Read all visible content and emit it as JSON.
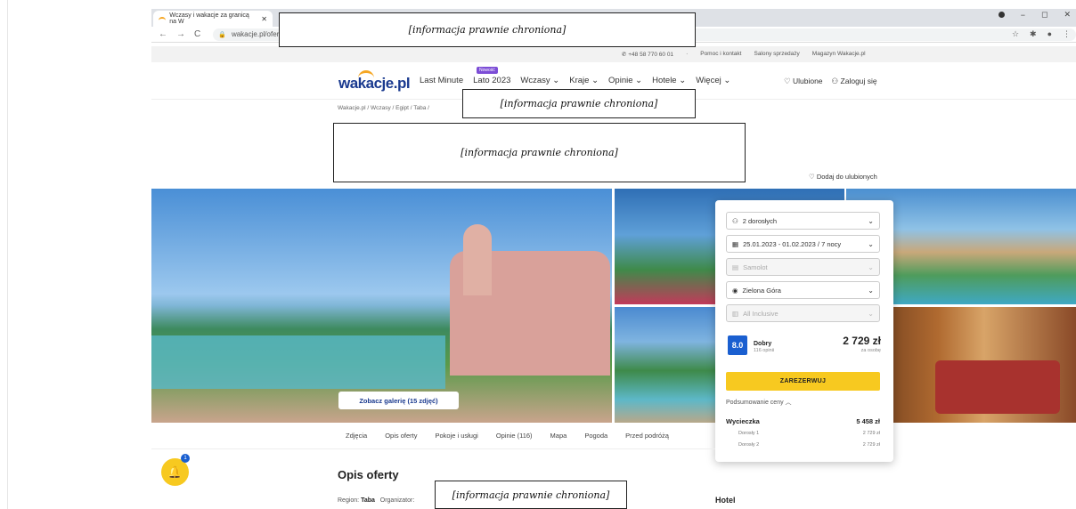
{
  "browser": {
    "tab_title": "Wczasy i wakacje za granicą na W",
    "tab_close": "✕",
    "url": "wakacje.pl/oferty/e",
    "nav_back": "←",
    "nav_forward": "→",
    "nav_reload": "C",
    "win_minimize": "−",
    "win_maximize": "◻",
    "win_close": "✕",
    "star": "☆",
    "ext": "✱",
    "profile": "●",
    "menu": "⋮"
  },
  "redacted_text": "[informacja prawnie chroniona]",
  "utilbar": {
    "phone": "+48 58 770 60 01",
    "sep": "·",
    "links": [
      "Pomoc i kontakt",
      "Salony sprzedaży",
      "Magazyn Wakacje.pl"
    ]
  },
  "logo": {
    "name": "wakacje",
    "tld": ".pl"
  },
  "nav": {
    "last_minute": "Last Minute",
    "new_badge": "Nowość",
    "lato": "Lato 2023",
    "wczasy": "Wczasy",
    "kraje": "Kraje",
    "opinie": "Opinie",
    "hotele": "Hotele",
    "wiecej": "Więcej",
    "ulubione": "Ulubione",
    "zaloguj": "Zaloguj się"
  },
  "breadcrumb": "Wakacje.pl  /  Wczasy  /  Egipt  /  Taba  /",
  "favorite_link": "Dodaj do ulubionych",
  "gallery_button": "Zobacz galerię (15 zdjęć)",
  "booking": {
    "travelers": "2 dorosłych",
    "dates": "25.01.2023 - 01.02.2023 / 7 nocy",
    "transport": "Samolot",
    "departure": "Zielona Góra",
    "board": "All Inclusive",
    "score": "8.0",
    "score_label": "Dobry",
    "reviews": "116 opinii",
    "price": "2 729 zł",
    "price_per": "za osobę",
    "reserve": "ZAREZERWUJ",
    "summary_toggle": "Podsumowanie ceny",
    "trip_label": "Wycieczka",
    "trip_total": "5 458 zł",
    "adult1_label": "Dorosły 1",
    "adult1_price": "2 729 zł",
    "adult2_label": "Dorosły 2",
    "adult2_price": "2 729 zł"
  },
  "section_tabs": [
    "Zdjęcia",
    "Opis oferty",
    "Pokoje i usługi",
    "Opinie (116)",
    "Mapa",
    "Pogoda",
    "Przed podróżą"
  ],
  "chat_count": "1",
  "offer_title": "Opis oferty",
  "region_label": "Region:",
  "region_value": "Taba",
  "organizer_label": "Organizator:",
  "hotel_label": "Hotel",
  "colors": {
    "brand_blue": "#1a3a8f",
    "accent_yellow": "#f7c920",
    "badge_purple": "#7c4dd6",
    "score_blue": "#1a5fd0"
  }
}
